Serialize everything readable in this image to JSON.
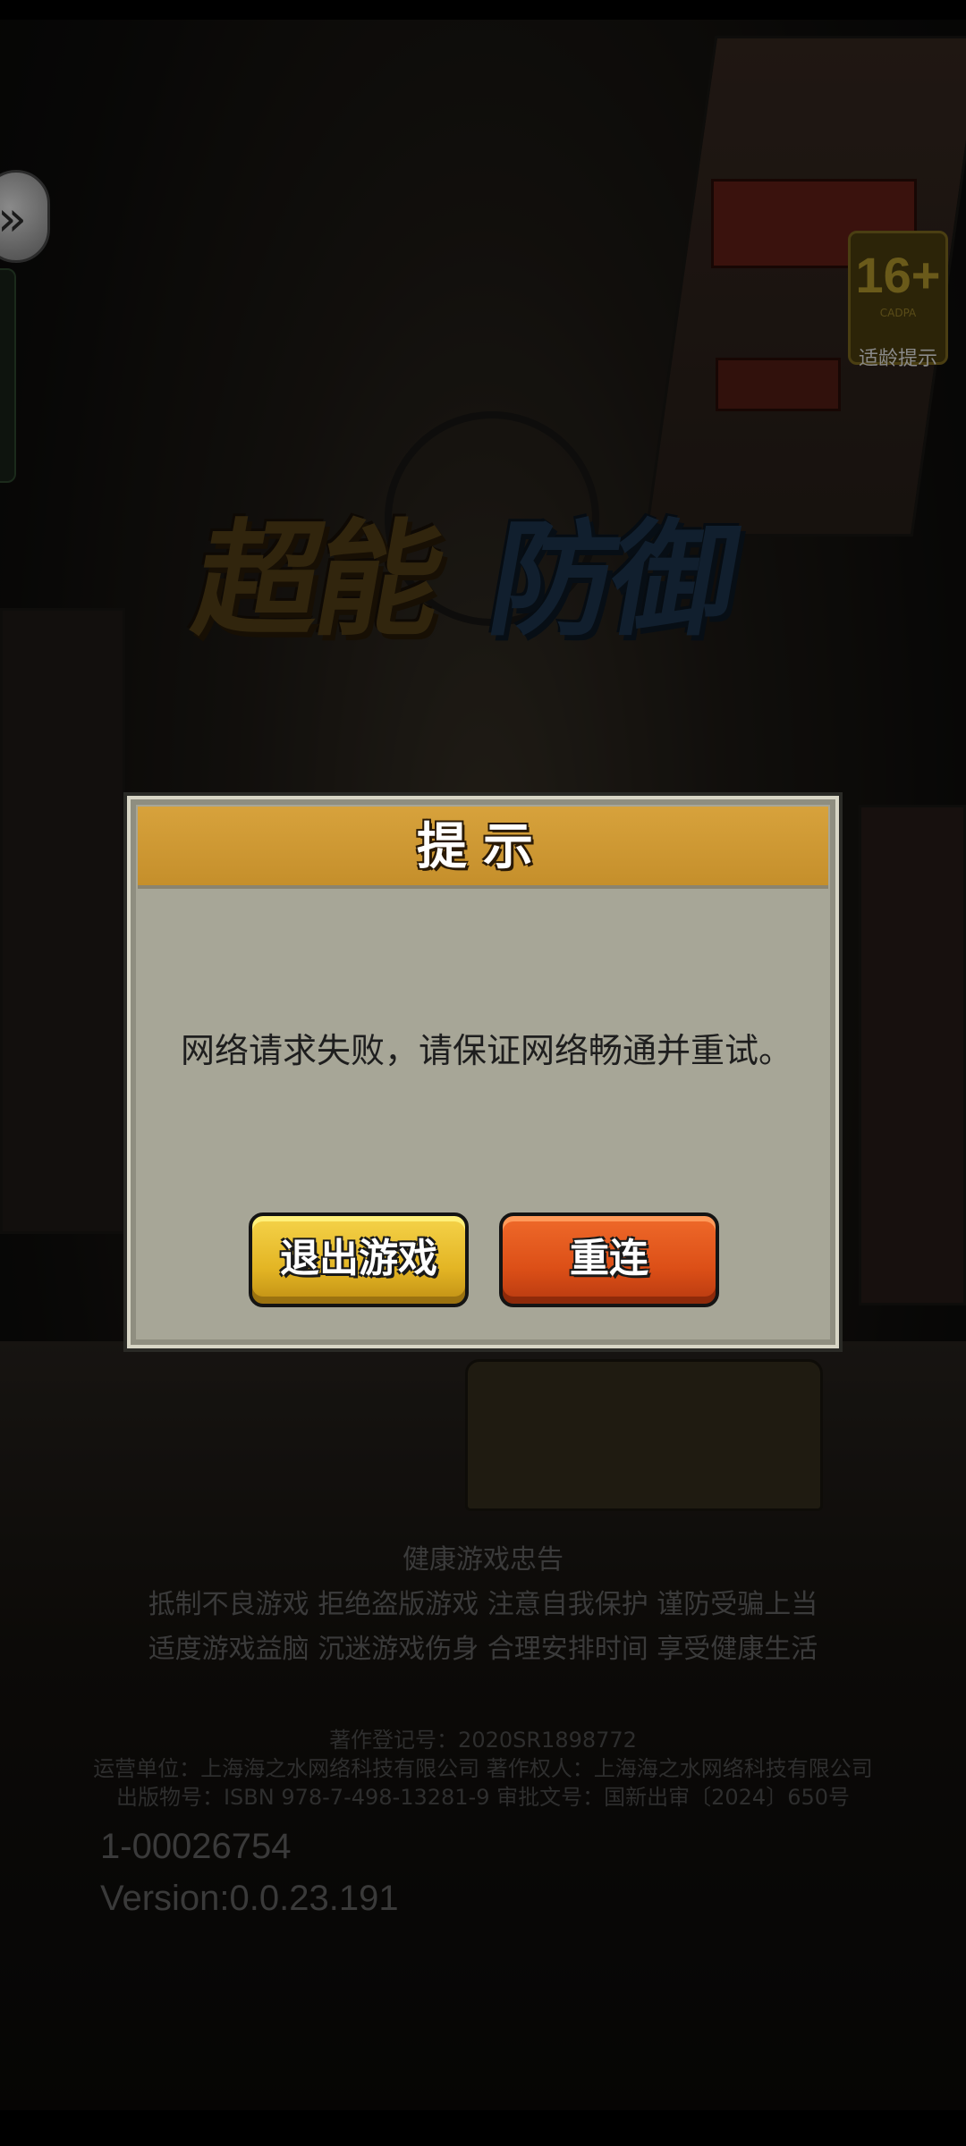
{
  "app": {
    "logo_left": "超能",
    "logo_right": "防御"
  },
  "age_badge": {
    "number": "16+",
    "sub": "CADPA",
    "label": "适龄提示"
  },
  "side_button": {
    "glyph": "»"
  },
  "dialog": {
    "title": "提示",
    "message": "网络请求失败，请保证网络畅通并重试。",
    "buttons": {
      "exit": "退出游戏",
      "retry": "重连"
    }
  },
  "health_notice": {
    "title": "健康游戏忠告",
    "line1": "抵制不良游戏  拒绝盗版游戏  注意自我保护  谨防受骗上当",
    "line2": "适度游戏益脑  沉迷游戏伤身  合理安排时间  享受健康生活"
  },
  "legal": {
    "copyright_reg": "著作登记号：2020SR1898772",
    "operator": "运营单位：上海海之水网络科技有限公司  著作权人：上海海之水网络科技有限公司",
    "publication": "出版物号：ISBN 978-7-498-13281-9  审批文号：国新出审〔2024〕650号"
  },
  "ids": {
    "user_id": "1-00026754",
    "version": "Version:0.0.23.191"
  },
  "colors": {
    "header": "#d7a23c",
    "exit_button": "#e3b524",
    "retry_button": "#dc4f17",
    "dialog_bg": "#a7a697"
  }
}
